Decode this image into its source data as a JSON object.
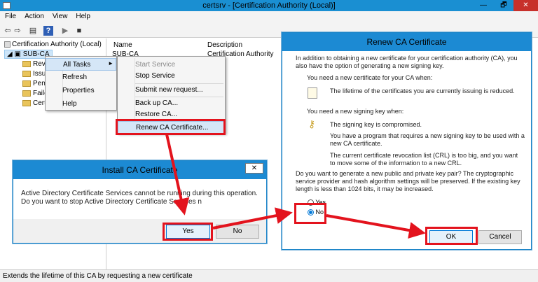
{
  "window": {
    "title": "certsrv - [Certification Authority (Local)]",
    "min_symbol": "—",
    "max_symbol": "🗗",
    "close_symbol": "✕"
  },
  "menubar": [
    "File",
    "Action",
    "View",
    "Help"
  ],
  "tree": {
    "root": "Certification Authority (Local)",
    "ca": "SUB-CA",
    "folders": [
      "Rev",
      "Issu",
      "Pen",
      "Faile",
      "Cert"
    ]
  },
  "list": {
    "col_name": "Name",
    "col_desc": "Description",
    "row_name": "SUB-CA",
    "row_desc": "Certification Authority"
  },
  "context_menu": [
    "All Tasks",
    "Refresh",
    "Properties",
    "Help"
  ],
  "submenu": {
    "start": "Start Service",
    "stop": "Stop Service",
    "submit": "Submit new request...",
    "backup": "Back up CA...",
    "restore": "Restore CA...",
    "renew": "Renew CA Certificate..."
  },
  "install_dialog": {
    "title": "Install CA Certificate",
    "message": "Active Directory Certificate Services cannot be running during this operation. Do you want to stop Active Directory Certificate Services n",
    "yes": "Yes",
    "no": "No"
  },
  "renew_dialog": {
    "title": "Renew CA Certificate",
    "intro": "In addition to obtaining a new certificate for your certification authority (CA), you also have the option of generating a new signing key.",
    "need_cert": "You need a new certificate for your CA when:",
    "lifetime": "The lifetime of the certificates you are currently issuing is reduced.",
    "need_key": "You need a new signing key when:",
    "compromised": "The signing key is compromised.",
    "program": "You have a program that requires a new signing key to be used with a new CA certificate.",
    "crl": "The current certificate revocation list (CRL) is too big, and you want to move some of the information to a new CRL.",
    "question": "Do you want to generate a new public and private key pair? The cryptographic service provider and hash algorithm settings will be preserved.  If the existing key length is less than 1024 bits, it may be increased.",
    "yes_option": "Yes",
    "no_option": "No",
    "ok": "OK",
    "cancel": "Cancel"
  },
  "status": "Extends the lifetime of this CA by requesting a new certificate",
  "colors": {
    "highlight_red": "#e3131d",
    "title_blue": "#1c8ad3"
  }
}
